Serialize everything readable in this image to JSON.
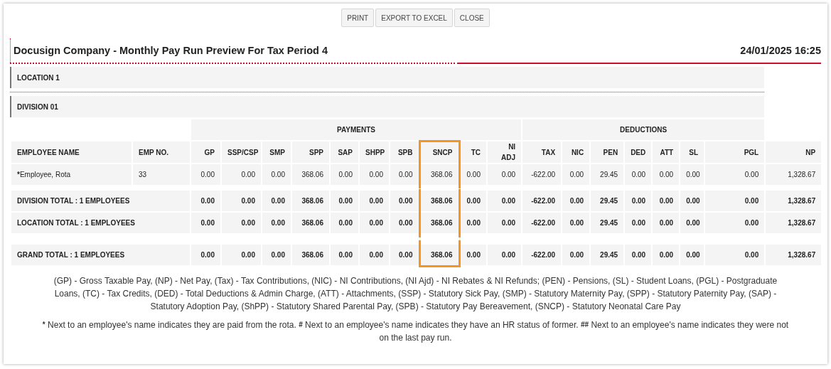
{
  "buttons": [
    "PRINT",
    "EXPORT TO EXCEL",
    "CLOSE"
  ],
  "report": {
    "title": "Docusign Company - Monthly Pay Run Preview For Tax Period 4",
    "timestamp": "24/01/2025 16:25"
  },
  "location": "LOCATION 1",
  "division": "DIVISION 01",
  "columns": {
    "name": "EMPLOYEE NAME",
    "emp_no": "EMP NO.",
    "groups": [
      {
        "label": "PAYMENTS",
        "columns": [
          {
            "label": "GP",
            "highlighted": false
          },
          {
            "label": "SSP/CSP",
            "highlighted": false
          },
          {
            "label": "SMP",
            "highlighted": false
          },
          {
            "label": "SPP",
            "highlighted": false
          },
          {
            "label": "SAP",
            "highlighted": false
          },
          {
            "label": "SHPP",
            "highlighted": false
          },
          {
            "label": "SPB",
            "highlighted": false
          },
          {
            "label": "SNCP",
            "highlighted": true
          },
          {
            "label": "TC",
            "highlighted": false
          },
          {
            "label": "NI ADJ",
            "highlighted": false
          }
        ]
      },
      {
        "label": "DEDUCTIONS",
        "columns": [
          {
            "label": "TAX",
            "highlighted": false
          },
          {
            "label": "NIC",
            "highlighted": false
          },
          {
            "label": "PEN",
            "highlighted": false
          },
          {
            "label": "DED",
            "highlighted": false
          },
          {
            "label": "ATT",
            "highlighted": false
          },
          {
            "label": "SL",
            "highlighted": false
          },
          {
            "label": "PGL",
            "highlighted": false
          }
        ]
      }
    ],
    "net": "NP"
  },
  "employees": [
    {
      "marker": "*",
      "name": "Employee, Rota",
      "emp_no": "33",
      "values": [
        "0.00",
        "0.00",
        "0.00",
        "368.06",
        "0.00",
        "0.00",
        "0.00",
        "368.06",
        "0.00",
        "0.00",
        "-622.00",
        "0.00",
        "29.45",
        "0.00",
        "0.00",
        "0.00",
        "0.00",
        "1,328.67"
      ]
    }
  ],
  "subtotals": [
    {
      "label": "DIVISION TOTAL : 1 EMPLOYEES",
      "values": [
        "0.00",
        "0.00",
        "0.00",
        "368.06",
        "0.00",
        "0.00",
        "0.00",
        "368.06",
        "0.00",
        "0.00",
        "-622.00",
        "0.00",
        "29.45",
        "0.00",
        "0.00",
        "0.00",
        "0.00",
        "1,328.67"
      ]
    },
    {
      "label": "LOCATION TOTAL : 1 EMPLOYEES",
      "values": [
        "0.00",
        "0.00",
        "0.00",
        "368.06",
        "0.00",
        "0.00",
        "0.00",
        "368.06",
        "0.00",
        "0.00",
        "-622.00",
        "0.00",
        "29.45",
        "0.00",
        "0.00",
        "0.00",
        "0.00",
        "1,328.67"
      ]
    }
  ],
  "grand_totals": [
    {
      "label": "GRAND TOTAL : 1 EMPLOYEES",
      "values": [
        "0.00",
        "0.00",
        "0.00",
        "368.06",
        "0.00",
        "0.00",
        "0.00",
        "368.06",
        "0.00",
        "0.00",
        "-622.00",
        "0.00",
        "29.45",
        "0.00",
        "0.00",
        "0.00",
        "0.00",
        "1,328.67"
      ]
    }
  ],
  "legend": "(GP) - Gross Taxable Pay, (NP) - Net Pay, (Tax) - Tax Contributions, (NIC) - NI Contributions, (NI Ajd) - NI Rebates & NI Refunds; (PEN) - Pensions, (SL) - Student Loans, (PGL) - Postgraduate Loans, (TC) - Tax Credits, (DED) - Total Deductions & Admin Charge, (ATT) - Attachments, (SSP) - Statutory Sick Pay, (SMP) - Statutory Maternity Pay, (SPP) - Statutory Paternity Pay, (SAP) - Statutory Adoption Pay, (ShPP) - Statutory Shared Parental Pay, (SPB) - Statutory Pay Bereavement, (SNCP) - Statutory Neonatal Care Pay",
  "footnotes": [
    {
      "marker": "*",
      "text": "Next to an employee's name indicates they are paid from the rota."
    },
    {
      "marker": "#",
      "text": "Next to an employee's name indicates they have an HR status of former."
    },
    {
      "marker": "##",
      "text": "Next to an employee's name indicates they were not on the last pay run."
    }
  ]
}
